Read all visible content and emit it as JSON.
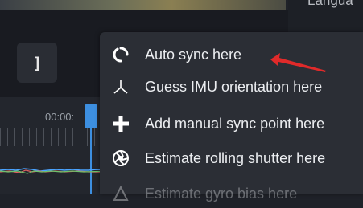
{
  "header": {
    "language_label": "Langua"
  },
  "toolbar": {
    "bracket_label": "]"
  },
  "timeline": {
    "time_label": "00:00:"
  },
  "context_menu": {
    "items": [
      {
        "label": "Auto sync here",
        "icon": "sync-icon"
      },
      {
        "label": "Guess IMU orientation here",
        "icon": "imu-axes-icon"
      },
      {
        "label": "Add manual sync point here",
        "icon": "plus-icon"
      },
      {
        "label": "Estimate rolling shutter here",
        "icon": "shutter-icon"
      },
      {
        "label": "Estimate gyro bias here",
        "icon": "bias-icon"
      }
    ]
  },
  "colors": {
    "accent": "#3d8fe0",
    "annotation_arrow": "#e02a2a",
    "menu_bg": "#2b2e35"
  }
}
